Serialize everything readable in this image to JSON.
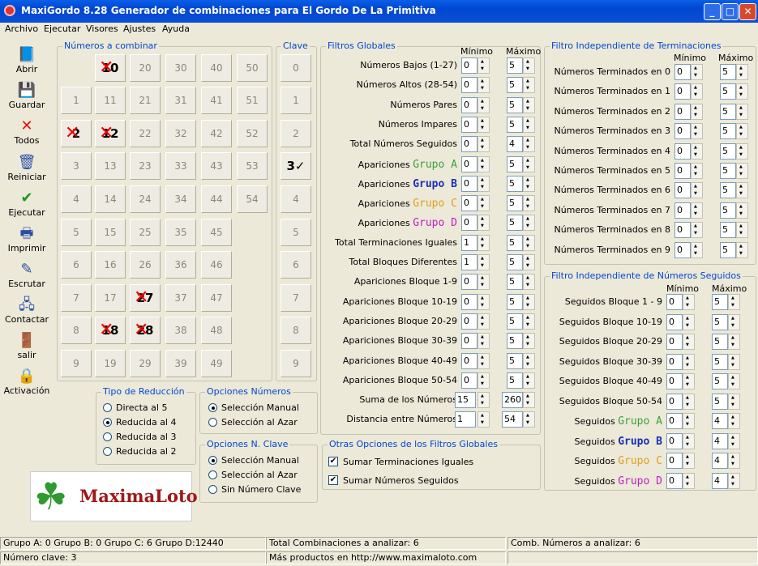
{
  "window": {
    "title": "MaxiGordo 8.28 Generador de combinaciones para El Gordo De La Primitiva"
  },
  "menu": [
    "Archivo",
    "Ejecutar",
    "Visores",
    "Ajustes",
    "Ayuda"
  ],
  "toolbar": [
    {
      "label": "Abrir",
      "icon": "open-book-icon",
      "glyph": "📘"
    },
    {
      "label": "Guardar",
      "icon": "floppy-disk-icon",
      "glyph": "💾"
    },
    {
      "label": "Todos",
      "icon": "red-x-icon",
      "glyph": "✕"
    },
    {
      "label": "Reiniciar",
      "icon": "trash-icon",
      "glyph": "🗑"
    },
    {
      "label": "Ejecutar",
      "icon": "checkmark-icon",
      "glyph": "✔"
    },
    {
      "label": "Imprimir",
      "icon": "printer-icon",
      "glyph": "🖶"
    },
    {
      "label": "Escrutar",
      "icon": "pencil-note-icon",
      "glyph": "✎"
    },
    {
      "label": "Contactar",
      "icon": "network-icon",
      "glyph": "🖧"
    },
    {
      "label": "salir",
      "icon": "exit-door-icon",
      "glyph": "🚪"
    },
    {
      "label": "Activación",
      "icon": "padlock-icon",
      "glyph": "🔒"
    }
  ],
  "numbers": {
    "legend": "Números a combinar",
    "cols": [
      [
        "",
        "1",
        "2",
        "3",
        "4",
        "5",
        "6",
        "7",
        "8",
        "9"
      ],
      [
        "10",
        "11",
        "12",
        "13",
        "14",
        "15",
        "16",
        "17",
        "18",
        "19"
      ],
      [
        "20",
        "21",
        "22",
        "23",
        "24",
        "25",
        "26",
        "27",
        "28",
        "29"
      ],
      [
        "30",
        "31",
        "32",
        "33",
        "34",
        "35",
        "36",
        "37",
        "38",
        "39"
      ],
      [
        "40",
        "41",
        "42",
        "43",
        "44",
        "45",
        "46",
        "47",
        "48",
        "49"
      ],
      [
        "50",
        "51",
        "52",
        "53",
        "54"
      ]
    ],
    "selected": [
      "2",
      "10",
      "12",
      "18",
      "27",
      "28"
    ]
  },
  "clave": {
    "legend": "Clave",
    "items": [
      "0",
      "1",
      "2",
      "3",
      "4",
      "5",
      "6",
      "7",
      "8",
      "9"
    ],
    "selected": "3"
  },
  "filtros": {
    "legend": "Filtros Globales",
    "min": "Mínimo",
    "max": "Máximo",
    "rows": [
      {
        "label": "Números Bajos (1-27)",
        "min": "0",
        "max": "5"
      },
      {
        "label": "Números Altos (28-54)",
        "min": "0",
        "max": "5"
      },
      {
        "label": "Números Pares",
        "min": "0",
        "max": "5"
      },
      {
        "label": "Números Impares",
        "min": "0",
        "max": "5"
      },
      {
        "label": "Total Números Seguidos",
        "min": "0",
        "max": "4"
      },
      {
        "label": "Apariciones",
        "group": "Grupo A",
        "cls": "gA",
        "min": "0",
        "max": "5"
      },
      {
        "label": "Apariciones",
        "group": "Grupo B",
        "cls": "gB",
        "min": "0",
        "max": "5"
      },
      {
        "label": "Apariciones",
        "group": "Grupo C",
        "cls": "gC",
        "min": "0",
        "max": "5"
      },
      {
        "label": "Apariciones",
        "group": "Grupo D",
        "cls": "gD",
        "min": "0",
        "max": "5"
      },
      {
        "label": "Total Terminaciones Iguales",
        "min": "1",
        "max": "5"
      },
      {
        "label": "Total Bloques Diferentes",
        "min": "1",
        "max": "5"
      },
      {
        "label": "Apariciones Bloque 1-9",
        "min": "0",
        "max": "5"
      },
      {
        "label": "Apariciones Bloque 10-19",
        "min": "0",
        "max": "5"
      },
      {
        "label": "Apariciones Bloque 20-29",
        "min": "0",
        "max": "5"
      },
      {
        "label": "Apariciones Bloque 30-39",
        "min": "0",
        "max": "5"
      },
      {
        "label": "Apariciones Bloque 40-49",
        "min": "0",
        "max": "5"
      },
      {
        "label": "Apariciones Bloque 50-54",
        "min": "0",
        "max": "5"
      },
      {
        "label": "Suma de los Números",
        "min": "15",
        "max": "260"
      },
      {
        "label": "Distancia entre Números",
        "min": "1",
        "max": "54"
      }
    ]
  },
  "terminaciones": {
    "legend": "Filtro Independiente de Terminaciones",
    "min": "Mínimo",
    "max": "Máximo",
    "rows": [
      {
        "label": "Números Terminados en 0",
        "min": "0",
        "max": "5"
      },
      {
        "label": "Números Terminados en 1",
        "min": "0",
        "max": "5"
      },
      {
        "label": "Números Terminados en 2",
        "min": "0",
        "max": "5"
      },
      {
        "label": "Números Terminados en 3",
        "min": "0",
        "max": "5"
      },
      {
        "label": "Números Terminados en 4",
        "min": "0",
        "max": "5"
      },
      {
        "label": "Números Terminados en 5",
        "min": "0",
        "max": "5"
      },
      {
        "label": "Números Terminados en 6",
        "min": "0",
        "max": "5"
      },
      {
        "label": "Números Terminados en 7",
        "min": "0",
        "max": "5"
      },
      {
        "label": "Números Terminados en 8",
        "min": "0",
        "max": "5"
      },
      {
        "label": "Números Terminados en 9",
        "min": "0",
        "max": "5"
      }
    ]
  },
  "seguidos": {
    "legend": "Filtro Independiente de Números Seguidos",
    "min": "Mínimo",
    "max": "Máximo",
    "rows": [
      {
        "label": "Seguidos Bloque  1 - 9",
        "min": "0",
        "max": "5"
      },
      {
        "label": "Seguidos Bloque 10-19",
        "min": "0",
        "max": "5"
      },
      {
        "label": "Seguidos Bloque 20-29",
        "min": "0",
        "max": "5"
      },
      {
        "label": "Seguidos Bloque 30-39",
        "min": "0",
        "max": "5"
      },
      {
        "label": "Seguidos Bloque 40-49",
        "min": "0",
        "max": "5"
      },
      {
        "label": "Seguidos Bloque 50-54",
        "min": "0",
        "max": "5"
      },
      {
        "label": "Seguidos",
        "group": "Grupo A",
        "cls": "gA",
        "min": "0",
        "max": "4"
      },
      {
        "label": "Seguidos",
        "group": "Grupo B",
        "cls": "gB",
        "min": "0",
        "max": "4"
      },
      {
        "label": "Seguidos",
        "group": "Grupo C",
        "cls": "gC",
        "min": "0",
        "max": "4"
      },
      {
        "label": "Seguidos",
        "group": "Grupo D",
        "cls": "gD",
        "min": "0",
        "max": "4"
      }
    ]
  },
  "reduccion": {
    "legend": "Tipo de Reducción",
    "options": [
      "Directa al 5",
      "Reducida al 4",
      "Reducida al 3",
      "Reducida al 2"
    ],
    "selected": 1
  },
  "opcNumeros": {
    "legend": "Opciones Números",
    "options": [
      "Selección Manual",
      "Selección al Azar"
    ],
    "selected": 0
  },
  "opcClave": {
    "legend": "Opciones N. Clave",
    "options": [
      "Selección Manual",
      "Selección al Azar",
      "Sin Número Clave"
    ],
    "selected": 0
  },
  "otras": {
    "legend": "Otras Opciones de los Filtros Globales",
    "options": [
      {
        "label": "Sumar Terminaciones Iguales",
        "checked": true
      },
      {
        "label": "Sumar Números Seguidos",
        "checked": true
      }
    ]
  },
  "logo": {
    "text": "MaximaLoto"
  },
  "status": {
    "grupos": "Grupo A: 0    Grupo B: 0    Grupo C: 6    Grupo D:12440",
    "total": "Total Combinaciones a analizar: 6",
    "comb": "Comb. Números a analizar: 6",
    "clave": "Número clave:   3",
    "web": "Más productos en http://www.maximaloto.com"
  }
}
